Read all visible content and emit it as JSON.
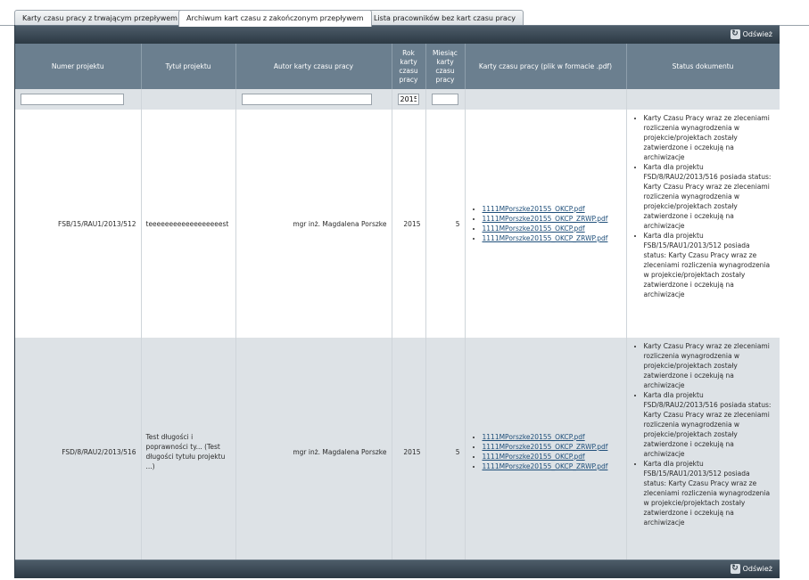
{
  "tabs": [
    {
      "label": "Karty czasu pracy z trwającym przepływem",
      "active": false
    },
    {
      "label": "Archiwum kart czasu z zakończonym przepływem",
      "active": true
    },
    {
      "label": "Lista pracowników bez kart czasu pracy",
      "active": false
    }
  ],
  "toolbar": {
    "refresh_label": "Odśwież"
  },
  "columns": [
    "Numer projektu",
    "Tytuł projektu",
    "Autor karty czasu pracy",
    "Rok karty czasu pracy",
    "Miesiąc karty czasu pracy",
    "Karty czasu pracy (plik w formacie .pdf)",
    "Status dokumentu"
  ],
  "filters": {
    "year_value": "2015",
    "month_value": "",
    "project_value": "",
    "author_value": ""
  },
  "rows": [
    {
      "project_number": "FSB/15/RAU1/2013/512",
      "title": "teeeeeeeeeeeeeeeeeest",
      "author": "mgr inż. Magdalena Porszke",
      "year": "2015",
      "month": "5",
      "files": [
        "1111MPorszke20155_OKCP.pdf",
        "1111MPorszke20155_OKCP_ZRWP.pdf",
        "1111MPorszke20155_OKCP.pdf",
        "1111MPorszke20155_OKCP_ZRWP.pdf"
      ],
      "status": [
        "Karty Czasu Pracy wraz ze zleceniami rozliczenia wynagrodzenia w projekcie/projektach zostały zatwierdzone i oczekują na archiwizacje",
        "Karta dla projektu FSD/8/RAU2/2013/516 posiada status: Karty Czasu Pracy wraz ze zleceniami rozliczenia wynagrodzenia w projekcie/projektach zostały zatwierdzone i oczekują na archiwizacje",
        "Karta dla projektu FSB/15/RAU1/2013/512 posiada status: Karty Czasu Pracy wraz ze zleceniami rozliczenia wynagrodzenia w projekcie/projektach zostały zatwierdzone i oczekują na archiwizacje"
      ]
    },
    {
      "project_number": "FSD/8/RAU2/2013/516",
      "title": "Test długości i poprawności ty... (Test długości tytułu projektu ...)",
      "author": "mgr inż. Magdalena Porszke",
      "year": "2015",
      "month": "5",
      "files": [
        "1111MPorszke20155_OKCP.pdf",
        "1111MPorszke20155_OKCP_ZRWP.pdf",
        "1111MPorszke20155_OKCP.pdf",
        "1111MPorszke20155_OKCP_ZRWP.pdf"
      ],
      "status": [
        "Karty Czasu Pracy wraz ze zleceniami rozliczenia wynagrodzenia w projekcie/projektach zostały zatwierdzone i oczekują na archiwizacje",
        "Karta dla projektu FSD/8/RAU2/2013/516 posiada status: Karty Czasu Pracy wraz ze zleceniami rozliczenia wynagrodzenia w projekcie/projektach zostały zatwierdzone i oczekują na archiwizacje",
        "Karta dla projektu FSB/15/RAU1/2013/512 posiada status: Karty Czasu Pracy wraz ze zleceniami rozliczenia wynagrodzenia w projekcie/projektach zostały zatwierdzone i oczekują na archiwizacje"
      ]
    }
  ]
}
